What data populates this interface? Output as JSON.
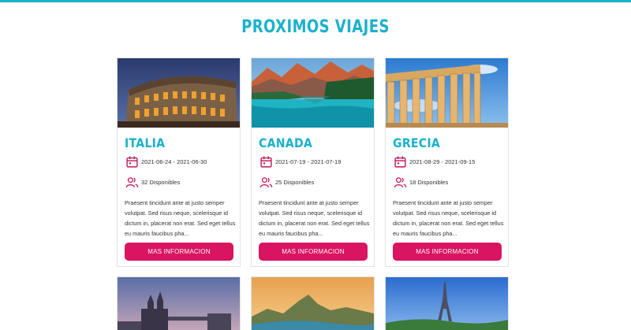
{
  "page": {
    "title": "PROXIMOS VIAJES"
  },
  "trips": [
    {
      "name": "ITALIA",
      "dates": "2021-06-24 - 2021-06-30",
      "available": "32 Disponibles",
      "description": "Praesent tincidunt ante at justo semper volutpat. Sed risus neque, scelerisque id dictum in, placerat non erat. Sed eget tellus eu mauris faucibus pha...",
      "button": "MAS INFORMACION",
      "image": "colosseum"
    },
    {
      "name": "CANADA",
      "dates": "2021-07-19 - 2021-07-19",
      "available": "25 Disponibles",
      "description": "Praesent tincidunt ante at justo semper volutpat. Sed risus neque, scelerisque id dictum in, placerat non erat. Sed eget tellus eu mauris faucibus pha...",
      "button": "MAS INFORMACION",
      "image": "mountain-lake"
    },
    {
      "name": "GRECIA",
      "dates": "2021-08-29 - 2021-09-15",
      "available": "18 Disponibles",
      "description": "Praesent tincidunt ante at justo semper volutpat. Sed risus neque, scelerisque id dictum in, placerat non erat. Sed eget tellus eu mauris faucibus pha...",
      "button": "MAS INFORMACION",
      "image": "parthenon"
    }
  ],
  "more_trips": [
    {
      "image": "tower-bridge"
    },
    {
      "image": "rio-coast"
    },
    {
      "image": "eiffel-tower"
    }
  ],
  "colors": {
    "accent": "#1ab1cc",
    "button": "#d91460",
    "icon": "#c2185b"
  },
  "icons": {
    "date": "calendar-icon",
    "people": "users-icon"
  }
}
